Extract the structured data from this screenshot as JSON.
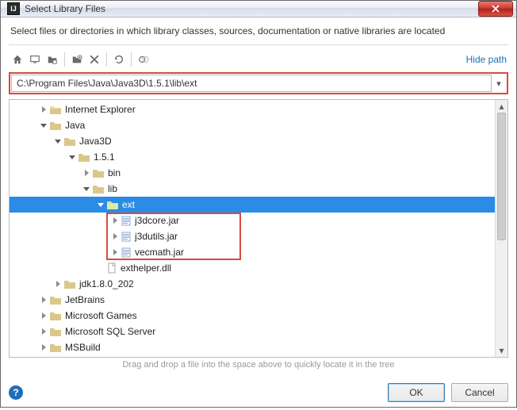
{
  "titlebar": {
    "title": "Select Library Files"
  },
  "description": "Select files or directories in which library classes, sources, documentation or native libraries are located",
  "toolbar": {
    "hide_path": "Hide path"
  },
  "path": {
    "value": "C:\\Program Files\\Java\\Java3D\\1.5.1\\lib\\ext"
  },
  "tree": {
    "ie": "Internet Explorer",
    "java": "Java",
    "java3d": "Java3D",
    "v": "1.5.1",
    "bin": "bin",
    "lib": "lib",
    "ext": "ext",
    "jar1": "j3dcore.jar",
    "jar2": "j3dutils.jar",
    "jar3": "vecmath.jar",
    "exthelper": "exthelper.dll",
    "jdk": "jdk1.8.0_202",
    "jetbrains": "JetBrains",
    "msgames": "Microsoft Games",
    "mssql": "Microsoft SQL Server",
    "msbuild": "MSBuild"
  },
  "hint": "Drag and drop a file into the space above to quickly locate it in the tree",
  "buttons": {
    "ok": "OK",
    "cancel": "Cancel"
  }
}
